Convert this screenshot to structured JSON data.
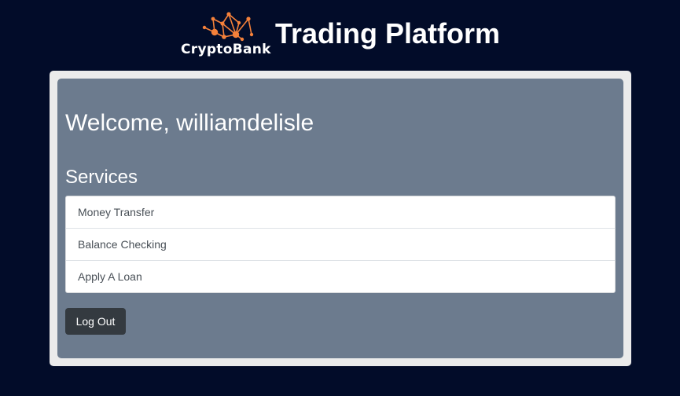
{
  "header": {
    "logo_text": "CryptoBank",
    "title": "Trading Platform"
  },
  "main": {
    "welcome": "Welcome, williamdelisle",
    "services_heading": "Services",
    "services": [
      {
        "label": "Money Transfer"
      },
      {
        "label": "Balance Checking"
      },
      {
        "label": "Apply A Loan"
      }
    ],
    "logout_label": "Log Out"
  },
  "colors": {
    "page_background": "#020c29",
    "card_outer": "#ebebeb",
    "card_inner": "#6c7b8e",
    "logo_accent": "#f5813a",
    "button": "#343a40"
  },
  "icons": {
    "logo": "network-nodes-icon"
  }
}
